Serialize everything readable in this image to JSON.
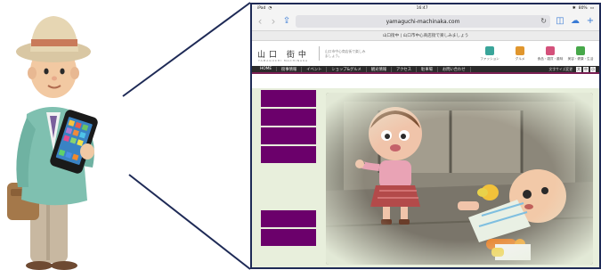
{
  "status": {
    "carrier": "iPad",
    "time": "16:47",
    "battery": "80%"
  },
  "browser": {
    "url": "yamaguchi-machinaka.com",
    "tab_title": "山口街中 | 山口市中心商店街で楽しみましょう"
  },
  "site": {
    "logo_text": "山口 街中",
    "logo_sub": "YAMAGUCHI MACHINAKA",
    "tagline": "山口市中心商店街で楽しみましょう。",
    "categories": [
      {
        "label": "ファッション",
        "color": "#3aa59a"
      },
      {
        "label": "グルメ",
        "color": "#e0962e"
      },
      {
        "label": "食品・雑貨・趣味",
        "color": "#d4517b"
      },
      {
        "label": "美容・健康・生活",
        "color": "#47a84a"
      }
    ],
    "nav": [
      "HOME",
      "街事情報",
      "イベント",
      "ショップ&グルメ",
      "観光情報",
      "アクセス",
      "駐車場",
      "お問い合わせ"
    ],
    "font_size_label": "文字サイズ変更",
    "font_sizes": [
      "大",
      "中",
      "小"
    ]
  },
  "colors": {
    "sidebar_button": "#6b006b",
    "content_bg": "#e8efdc",
    "frame": "#1e2a56"
  }
}
